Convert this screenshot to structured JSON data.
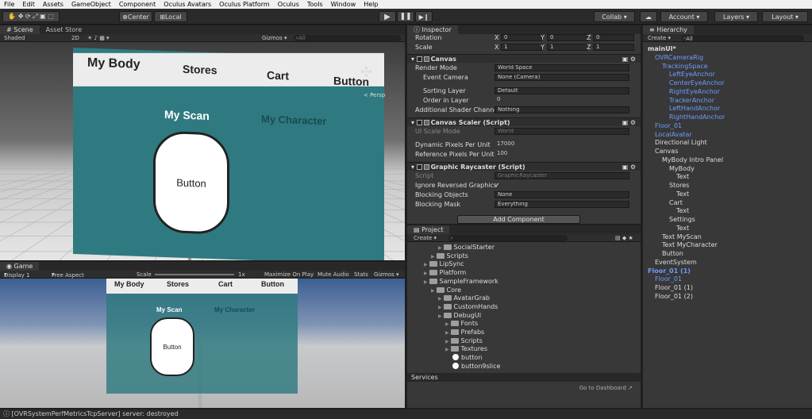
{
  "menu": [
    "File",
    "Edit",
    "Assets",
    "GameObject",
    "Component",
    "Oculus Avatars",
    "Oculus Platform",
    "Oculus",
    "Tools",
    "Window",
    "Help"
  ],
  "toolbar": {
    "center": "Center",
    "local": "Local",
    "collab": "Collab ▾",
    "account": "Account",
    "layers": "Layers",
    "layout": "Layout"
  },
  "scene": {
    "tab": "Scene",
    "asset_tab": "Asset Store",
    "shaded": "Shaded",
    "mode_2d": "2D",
    "gizmos": "Gizmos ▾",
    "persp": "< Persp",
    "nav": [
      "My Body",
      "Stores",
      "Cart",
      "Button"
    ],
    "scan": "My Scan",
    "character": "My Character",
    "button": "Button"
  },
  "game": {
    "tab": "Game",
    "display": "Display 1",
    "aspect": "Free Aspect",
    "scale": "Scale",
    "scale_val": "1x",
    "maximize": "Maximize On Play",
    "mute": "Mute Audio",
    "stats": "Stats",
    "gizmos": "Gizmos ▾",
    "nav": [
      "My Body",
      "Stores",
      "Cart",
      "Button"
    ],
    "scan": "My Scan",
    "character": "My Character",
    "button": "Button"
  },
  "inspector": {
    "tab": "Inspector",
    "rotation": {
      "label": "Rotation",
      "x": "0",
      "y": "0",
      "z": "0"
    },
    "scale": {
      "label": "Scale",
      "x": "1",
      "y": "1",
      "z": "1"
    },
    "canvas": {
      "title": "Canvas",
      "render_mode_label": "Render Mode",
      "render_mode": "World Space",
      "event_camera_label": "Event Camera",
      "event_camera": "None (Camera)",
      "sorting_layer_label": "Sorting Layer",
      "sorting_layer": "Default",
      "order_label": "Order in Layer",
      "order": "0",
      "shader_label": "Additional Shader Channe",
      "shader": "Nothing"
    },
    "scaler": {
      "title": "Canvas Scaler (Script)",
      "ui_scale_label": "UI Scale Mode",
      "ui_scale": "World",
      "dynamic_label": "Dynamic Pixels Per Unit",
      "dynamic": "17000",
      "reference_label": "Reference Pixels Per Unit",
      "reference": "100"
    },
    "raycaster": {
      "title": "Graphic Raycaster (Script)",
      "script_label": "Script",
      "script": "GraphicRaycaster",
      "ignore_label": "Ignore Reversed Graphics",
      "blocking_label": "Blocking Objects",
      "blocking": "None",
      "mask_label": "Blocking Mask",
      "mask": "Everything"
    },
    "add_component": "Add Component"
  },
  "project": {
    "tab": "Project",
    "create": "Create ▾",
    "items": [
      {
        "l": "SocialStarter",
        "d": 3,
        "t": "f"
      },
      {
        "l": "Scripts",
        "d": 2,
        "t": "f"
      },
      {
        "l": "LipSync",
        "d": 1,
        "t": "f"
      },
      {
        "l": "Platform",
        "d": 1,
        "t": "f"
      },
      {
        "l": "SampleFramework",
        "d": 1,
        "t": "f"
      },
      {
        "l": "Core",
        "d": 2,
        "t": "f"
      },
      {
        "l": "AvatarGrab",
        "d": 3,
        "t": "f"
      },
      {
        "l": "CustomHands",
        "d": 3,
        "t": "f"
      },
      {
        "l": "DebugUI",
        "d": 3,
        "t": "f"
      },
      {
        "l": "Fonts",
        "d": 4,
        "t": "f"
      },
      {
        "l": "Prefabs",
        "d": 4,
        "t": "f"
      },
      {
        "l": "Scripts",
        "d": 4,
        "t": "f"
      },
      {
        "l": "Textures",
        "d": 4,
        "t": "f"
      },
      {
        "l": "button",
        "d": 5,
        "t": "i"
      },
      {
        "l": "button9slice",
        "d": 5,
        "t": "i"
      }
    ],
    "services": "Services",
    "dashboard": "Go to Dashboard"
  },
  "hierarchy": {
    "tab": "Hierarchy",
    "create": "Create ▾",
    "search": "All",
    "items": [
      {
        "l": "mainUI*",
        "d": 0,
        "c": "w"
      },
      {
        "l": "OVRCameraRig",
        "d": 1,
        "c": "b"
      },
      {
        "l": "TrackingSpace",
        "d": 2,
        "c": "b"
      },
      {
        "l": "LeftEyeAnchor",
        "d": 3,
        "c": "b"
      },
      {
        "l": "CenterEyeAnchor",
        "d": 3,
        "c": "b"
      },
      {
        "l": "RightEyeAnchor",
        "d": 3,
        "c": "b"
      },
      {
        "l": "TrackerAnchor",
        "d": 3,
        "c": "b"
      },
      {
        "l": "LeftHandAnchor",
        "d": 3,
        "c": "b"
      },
      {
        "l": "RightHandAnchor",
        "d": 3,
        "c": "b"
      },
      {
        "l": "Floor_01",
        "d": 1,
        "c": "b"
      },
      {
        "l": "LocalAvatar",
        "d": 1,
        "c": "b"
      },
      {
        "l": "Directional Light",
        "d": 1,
        "c": "w"
      },
      {
        "l": "Canvas",
        "d": 1,
        "c": "w"
      },
      {
        "l": "MyBody Intro Panel",
        "d": 2,
        "c": "w"
      },
      {
        "l": "MyBody",
        "d": 3,
        "c": "w"
      },
      {
        "l": "Text",
        "d": 4,
        "c": "w"
      },
      {
        "l": "Stores",
        "d": 3,
        "c": "w"
      },
      {
        "l": "Text",
        "d": 4,
        "c": "w"
      },
      {
        "l": "Cart",
        "d": 3,
        "c": "w"
      },
      {
        "l": "Text",
        "d": 4,
        "c": "w"
      },
      {
        "l": "Settings",
        "d": 3,
        "c": "w"
      },
      {
        "l": "Text",
        "d": 4,
        "c": "w"
      },
      {
        "l": "Text MyScan",
        "d": 2,
        "c": "w"
      },
      {
        "l": "Text MyCharacter",
        "d": 2,
        "c": "w"
      },
      {
        "l": "Button",
        "d": 2,
        "c": "w"
      },
      {
        "l": "EventSystem",
        "d": 1,
        "c": "w"
      },
      {
        "l": "Floor_01 (1)",
        "d": 0,
        "c": "b"
      },
      {
        "l": "Floor_01",
        "d": 1,
        "c": "b"
      },
      {
        "l": "Floor_01 (1)",
        "d": 1,
        "c": "w"
      },
      {
        "l": "Floor_01 (2)",
        "d": 1,
        "c": "w"
      }
    ]
  },
  "status": "[OVRSystemPerfMetricsTcpServer] server: destroyed",
  "colors": {
    "panel_teal": "#2f7a80",
    "header_gray": "#ececec",
    "link_blue": "#6e9cff"
  }
}
